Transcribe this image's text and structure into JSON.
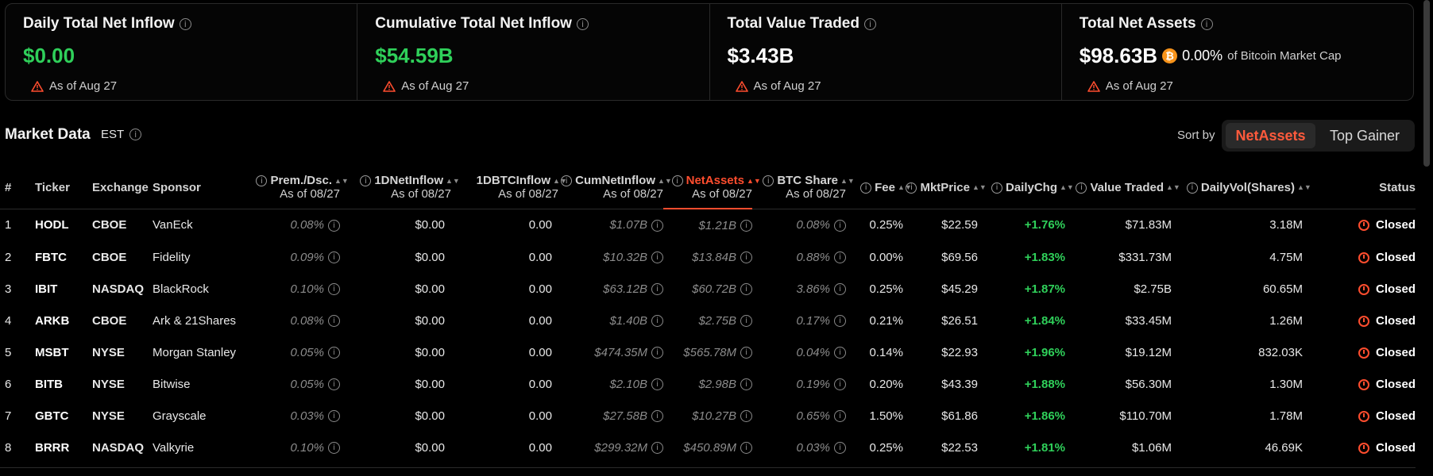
{
  "cards": [
    {
      "title": "Daily Total Net Inflow",
      "value": "$0.00",
      "asof": "As of Aug 27"
    },
    {
      "title": "Cumulative Total Net Inflow",
      "value": "$54.59B",
      "asof": "As of Aug 27"
    },
    {
      "title": "Total Value Traded",
      "value": "$3.43B",
      "asof": "As of Aug 27"
    },
    {
      "title": "Total Net Assets",
      "value": "$98.63B",
      "pct": "0.00%",
      "mcap_label": "of Bitcoin Market Cap",
      "asof": "As of Aug 27"
    }
  ],
  "market": {
    "title": "Market Data",
    "tz": "EST",
    "sortby_label": "Sort by",
    "sort_active": "NetAssets",
    "sort_other": "Top Gainer"
  },
  "headers": {
    "num": "#",
    "ticker": "Ticker",
    "exchange": "Exchange",
    "sponsor": "Sponsor",
    "prem": "Prem./Dsc.",
    "inflow": "1DNetInflow",
    "btcinflow": "1DBTCInflow",
    "cum": "CumNetInflow",
    "netassets": "NetAssets",
    "btcshare": "BTC Share",
    "fee": "Fee",
    "mktprice": "MktPrice",
    "dailychg": "DailyChg",
    "valtraded": "Value Traded",
    "dailyvol": "DailyVol(Shares)",
    "status": "Status",
    "asof": "As of 08/27"
  },
  "rows": [
    {
      "n": "1",
      "ticker": "HODL",
      "exchange": "CBOE",
      "sponsor": "VanEck",
      "prem": "0.08%",
      "inflow": "$0.00",
      "btcinflow": "0.00",
      "cum": "$1.07B",
      "netassets": "$1.21B",
      "btcshare": "0.08%",
      "fee": "0.25%",
      "price": "$22.59",
      "chg": "+1.76%",
      "traded": "$71.83M",
      "vol": "3.18M",
      "status": "Closed"
    },
    {
      "n": "2",
      "ticker": "FBTC",
      "exchange": "CBOE",
      "sponsor": "Fidelity",
      "prem": "0.09%",
      "inflow": "$0.00",
      "btcinflow": "0.00",
      "cum": "$10.32B",
      "netassets": "$13.84B",
      "btcshare": "0.88%",
      "fee": "0.00%",
      "price": "$69.56",
      "chg": "+1.83%",
      "traded": "$331.73M",
      "vol": "4.75M",
      "status": "Closed"
    },
    {
      "n": "3",
      "ticker": "IBIT",
      "exchange": "NASDAQ",
      "sponsor": "BlackRock",
      "prem": "0.10%",
      "inflow": "$0.00",
      "btcinflow": "0.00",
      "cum": "$63.12B",
      "netassets": "$60.72B",
      "btcshare": "3.86%",
      "fee": "0.25%",
      "price": "$45.29",
      "chg": "+1.87%",
      "traded": "$2.75B",
      "vol": "60.65M",
      "status": "Closed"
    },
    {
      "n": "4",
      "ticker": "ARKB",
      "exchange": "CBOE",
      "sponsor": "Ark & 21Shares",
      "prem": "0.08%",
      "inflow": "$0.00",
      "btcinflow": "0.00",
      "cum": "$1.40B",
      "netassets": "$2.75B",
      "btcshare": "0.17%",
      "fee": "0.21%",
      "price": "$26.51",
      "chg": "+1.84%",
      "traded": "$33.45M",
      "vol": "1.26M",
      "status": "Closed"
    },
    {
      "n": "5",
      "ticker": "MSBT",
      "exchange": "NYSE",
      "sponsor": "Morgan Stanley",
      "prem": "0.05%",
      "inflow": "$0.00",
      "btcinflow": "0.00",
      "cum": "$474.35M",
      "netassets": "$565.78M",
      "btcshare": "0.04%",
      "fee": "0.14%",
      "price": "$22.93",
      "chg": "+1.96%",
      "traded": "$19.12M",
      "vol": "832.03K",
      "status": "Closed"
    },
    {
      "n": "6",
      "ticker": "BITB",
      "exchange": "NYSE",
      "sponsor": "Bitwise",
      "prem": "0.05%",
      "inflow": "$0.00",
      "btcinflow": "0.00",
      "cum": "$2.10B",
      "netassets": "$2.98B",
      "btcshare": "0.19%",
      "fee": "0.20%",
      "price": "$43.39",
      "chg": "+1.88%",
      "traded": "$56.30M",
      "vol": "1.30M",
      "status": "Closed"
    },
    {
      "n": "7",
      "ticker": "GBTC",
      "exchange": "NYSE",
      "sponsor": "Grayscale",
      "prem": "0.03%",
      "inflow": "$0.00",
      "btcinflow": "0.00",
      "cum": "$27.58B",
      "netassets": "$10.27B",
      "btcshare": "0.65%",
      "fee": "1.50%",
      "price": "$61.86",
      "chg": "+1.86%",
      "traded": "$110.70M",
      "vol": "1.78M",
      "status": "Closed"
    },
    {
      "n": "8",
      "ticker": "BRRR",
      "exchange": "NASDAQ",
      "sponsor": "Valkyrie",
      "prem": "0.10%",
      "inflow": "$0.00",
      "btcinflow": "0.00",
      "cum": "$299.32M",
      "netassets": "$450.89M",
      "btcshare": "0.03%",
      "fee": "0.25%",
      "price": "$22.53",
      "chg": "+1.81%",
      "traded": "$1.06M",
      "vol": "46.69K",
      "status": "Closed"
    }
  ],
  "colors": {
    "accent": "#ff4d2e",
    "positive": "#2fd05a",
    "btc": "#f7931a"
  }
}
